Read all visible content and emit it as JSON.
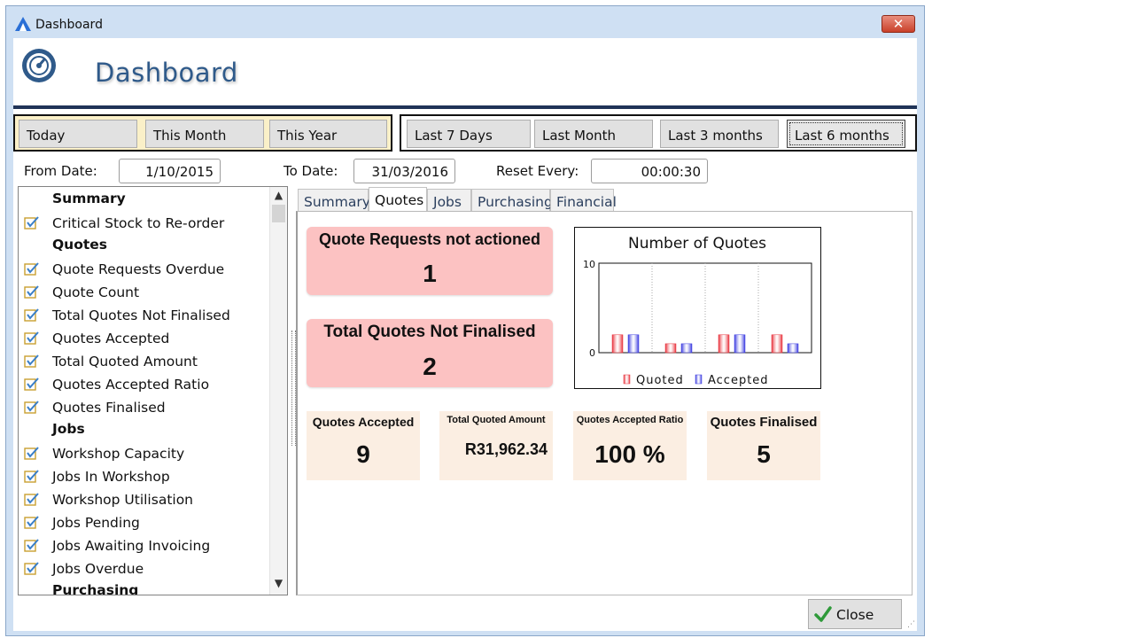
{
  "window": {
    "title": "Dashboard",
    "close_glyph": "✕"
  },
  "header": {
    "title": "Dashboard",
    "icon": "speedometer-icon"
  },
  "ranges_left": [
    "Today",
    "This Month",
    "This Year"
  ],
  "ranges_right": [
    "Last 7 Days",
    "Last Month",
    "Last 3 months",
    "Last 6 months"
  ],
  "selected_range": "Last 6 months",
  "filters": {
    "from_label": "From Date:",
    "from_value": "1/10/2015",
    "to_label": "To Date:",
    "to_value": "31/03/2016",
    "reset_label": "Reset Every:",
    "reset_value": "00:00:30"
  },
  "widget_list": [
    {
      "type": "header",
      "label": "Summary"
    },
    {
      "type": "item",
      "label": "Critical Stock to Re-order",
      "checked": true
    },
    {
      "type": "header",
      "label": "Quotes"
    },
    {
      "type": "item",
      "label": "Quote Requests Overdue",
      "checked": true
    },
    {
      "type": "item",
      "label": "Quote Count",
      "checked": true
    },
    {
      "type": "item",
      "label": "Total Quotes Not Finalised",
      "checked": true
    },
    {
      "type": "item",
      "label": "Quotes Accepted",
      "checked": true
    },
    {
      "type": "item",
      "label": "Total Quoted Amount",
      "checked": true
    },
    {
      "type": "item",
      "label": "Quotes Accepted Ratio",
      "checked": true
    },
    {
      "type": "item",
      "label": "Quotes Finalised",
      "checked": true
    },
    {
      "type": "header",
      "label": "Jobs"
    },
    {
      "type": "item",
      "label": "Workshop Capacity",
      "checked": true
    },
    {
      "type": "item",
      "label": "Jobs In Workshop",
      "checked": true
    },
    {
      "type": "item",
      "label": "Workshop Utilisation",
      "checked": true
    },
    {
      "type": "item",
      "label": "Jobs Pending",
      "checked": true
    },
    {
      "type": "item",
      "label": "Jobs Awaiting Invoicing",
      "checked": true
    },
    {
      "type": "item",
      "label": "Jobs Overdue",
      "checked": true
    },
    {
      "type": "header",
      "label": "Purchasing"
    }
  ],
  "tabs": [
    "Summary",
    "Quotes",
    "Jobs",
    "Purchasing",
    "Financial"
  ],
  "active_tab": "Quotes",
  "cards": {
    "not_actioned": {
      "title": "Quote Requests not actioned",
      "value": "1"
    },
    "not_finalised": {
      "title": "Total Quotes Not Finalised",
      "value": "2"
    },
    "accepted": {
      "title": "Quotes Accepted",
      "value": "9"
    },
    "amount": {
      "title": "Total Quoted Amount",
      "value": "R31,962.34"
    },
    "ratio": {
      "title": "Quotes Accepted Ratio",
      "value": "100 %"
    },
    "finalised": {
      "title": "Quotes Finalised",
      "value": "5"
    }
  },
  "chart_data": {
    "type": "bar",
    "title": "Number of Quotes",
    "categories": [
      "",
      "",
      "",
      ""
    ],
    "series": [
      {
        "name": "Quoted",
        "values": [
          2,
          1,
          2,
          2
        ],
        "color": "#e8303a"
      },
      {
        "name": "Accepted",
        "values": [
          2,
          1,
          2,
          1
        ],
        "color": "#3a3ae0"
      }
    ],
    "ylim": [
      0,
      10
    ],
    "yticks": [
      "0",
      "10"
    ],
    "legend": "bottom",
    "grid": "vertical dotted"
  },
  "footer": {
    "close_label": "Close"
  },
  "colors": {
    "red_card": "#fcc2c2",
    "tan_card": "#fbeee2",
    "title_blue": "#2f5a8a",
    "header_rule": "#1f3357"
  }
}
